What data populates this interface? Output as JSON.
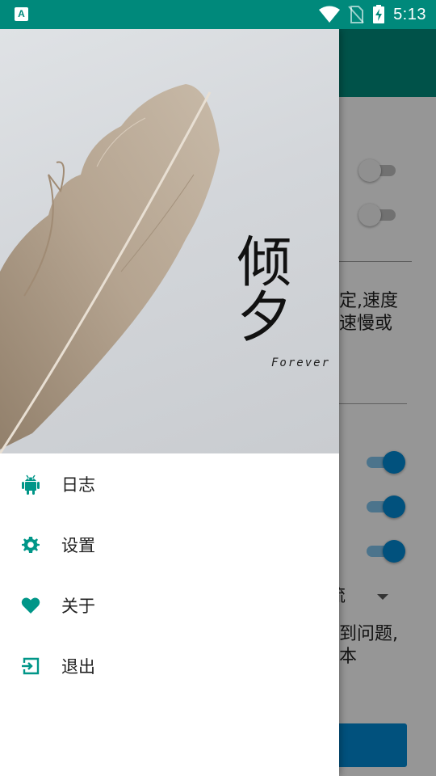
{
  "status_bar": {
    "time": "5:13",
    "icons": [
      "app-notification-icon",
      "wifi-icon",
      "no-sim-icon",
      "battery-charging-icon"
    ]
  },
  "colors": {
    "primary": "#00897b",
    "accent": "#0288d1",
    "icon": "#009688"
  },
  "drawer": {
    "header": {
      "title": "倾夕",
      "subtitle": "Forever"
    },
    "items": [
      {
        "label": "日志",
        "icon": "android-icon"
      },
      {
        "label": "设置",
        "icon": "gear-icon"
      },
      {
        "label": "关于",
        "icon": "heart-icon"
      },
      {
        "label": "退出",
        "icon": "exit-icon"
      }
    ]
  },
  "background": {
    "text1_line1": "定,速度",
    "text1_line2": "速慢或",
    "dropdown_partial": "流",
    "text2_line1": "到问题,",
    "text2_line2": "本",
    "toggles": [
      {
        "state": "off"
      },
      {
        "state": "off"
      },
      {
        "state": "on"
      },
      {
        "state": "on"
      },
      {
        "state": "on"
      }
    ]
  }
}
